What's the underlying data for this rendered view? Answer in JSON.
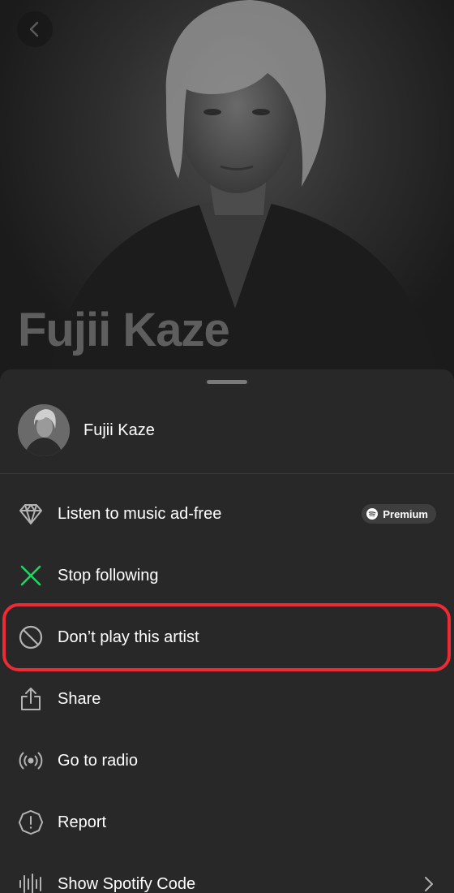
{
  "hero": {
    "artist_name": "Fujii Kaze"
  },
  "sheet": {
    "artist_name": "Fujii Kaze",
    "items": [
      {
        "icon": "diamond-icon",
        "label": "Listen to music ad-free",
        "badge": "Premium"
      },
      {
        "icon": "x-icon",
        "label": "Stop following"
      },
      {
        "icon": "block-icon",
        "label": "Don’t play this artist"
      },
      {
        "icon": "share-icon",
        "label": "Share"
      },
      {
        "icon": "radio-icon",
        "label": "Go to radio"
      },
      {
        "icon": "report-icon",
        "label": "Report"
      },
      {
        "icon": "spotify-code-icon",
        "label": "Show Spotify Code"
      }
    ]
  },
  "colors": {
    "sheet_bg": "#282828",
    "accent_green": "#1ed760",
    "highlight_red": "#ee2a35"
  }
}
